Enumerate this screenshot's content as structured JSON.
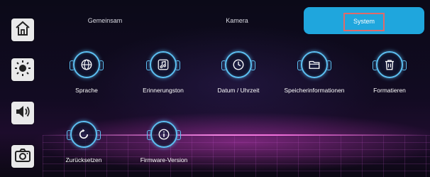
{
  "tabs": [
    {
      "label": "Gemeinsam",
      "active": false
    },
    {
      "label": "Kamera",
      "active": false
    },
    {
      "label": "System",
      "active": true
    }
  ],
  "sidebar": {
    "items": [
      {
        "icon": "home-icon"
      },
      {
        "icon": "brightness-icon"
      },
      {
        "icon": "volume-icon"
      },
      {
        "icon": "camera-icon"
      }
    ]
  },
  "system_items": [
    {
      "label": "Sprache",
      "icon": "globe-icon"
    },
    {
      "label": "Erinnerungston",
      "icon": "music-note-icon"
    },
    {
      "label": "Datum / Uhrzeit",
      "icon": "clock-icon"
    },
    {
      "label": "Speicherinformationen",
      "icon": "folder-icon"
    },
    {
      "label": "Formatieren",
      "icon": "trash-icon"
    },
    {
      "label": "Zurücksetzen",
      "icon": "reset-icon"
    },
    {
      "label": "Firmware-Version",
      "icon": "info-icon"
    }
  ],
  "colors": {
    "active_tab": "#1fa6dd",
    "icon_accent": "#5dc0f2",
    "highlight_border": "#e06a6a"
  }
}
